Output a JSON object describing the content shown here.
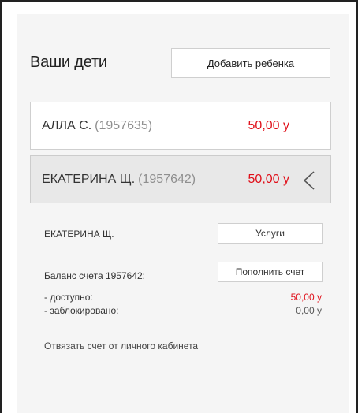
{
  "section": {
    "title": "Ваши дети",
    "add_button": "Добавить ребенка"
  },
  "children": [
    {
      "name": "АЛЛА С.",
      "id": "(1957635)",
      "amount": "50,00 у",
      "active": false
    },
    {
      "name": "ЕКАТЕРИНА Щ.",
      "id": "(1957642)",
      "amount": "50,00 у",
      "active": true
    }
  ],
  "details": {
    "name": "ЕКАТЕРИНА Щ.",
    "services_button": "Услуги",
    "balance_label": "Баланс счета 1957642:",
    "topup_button": "Пополнить счет",
    "available_label": "- доступно:",
    "available_value": "50,00 у",
    "blocked_label": "- заблокировано:",
    "blocked_value": "0,00 у",
    "unlink_link": "Отвязать счет от личного кабинета"
  },
  "colors": {
    "accent_red": "#e0101a",
    "panel_bg": "#f5f5f5",
    "active_card_bg": "#e8e8e8"
  },
  "icons": {
    "expand_indicator": "chevron-left-icon"
  }
}
